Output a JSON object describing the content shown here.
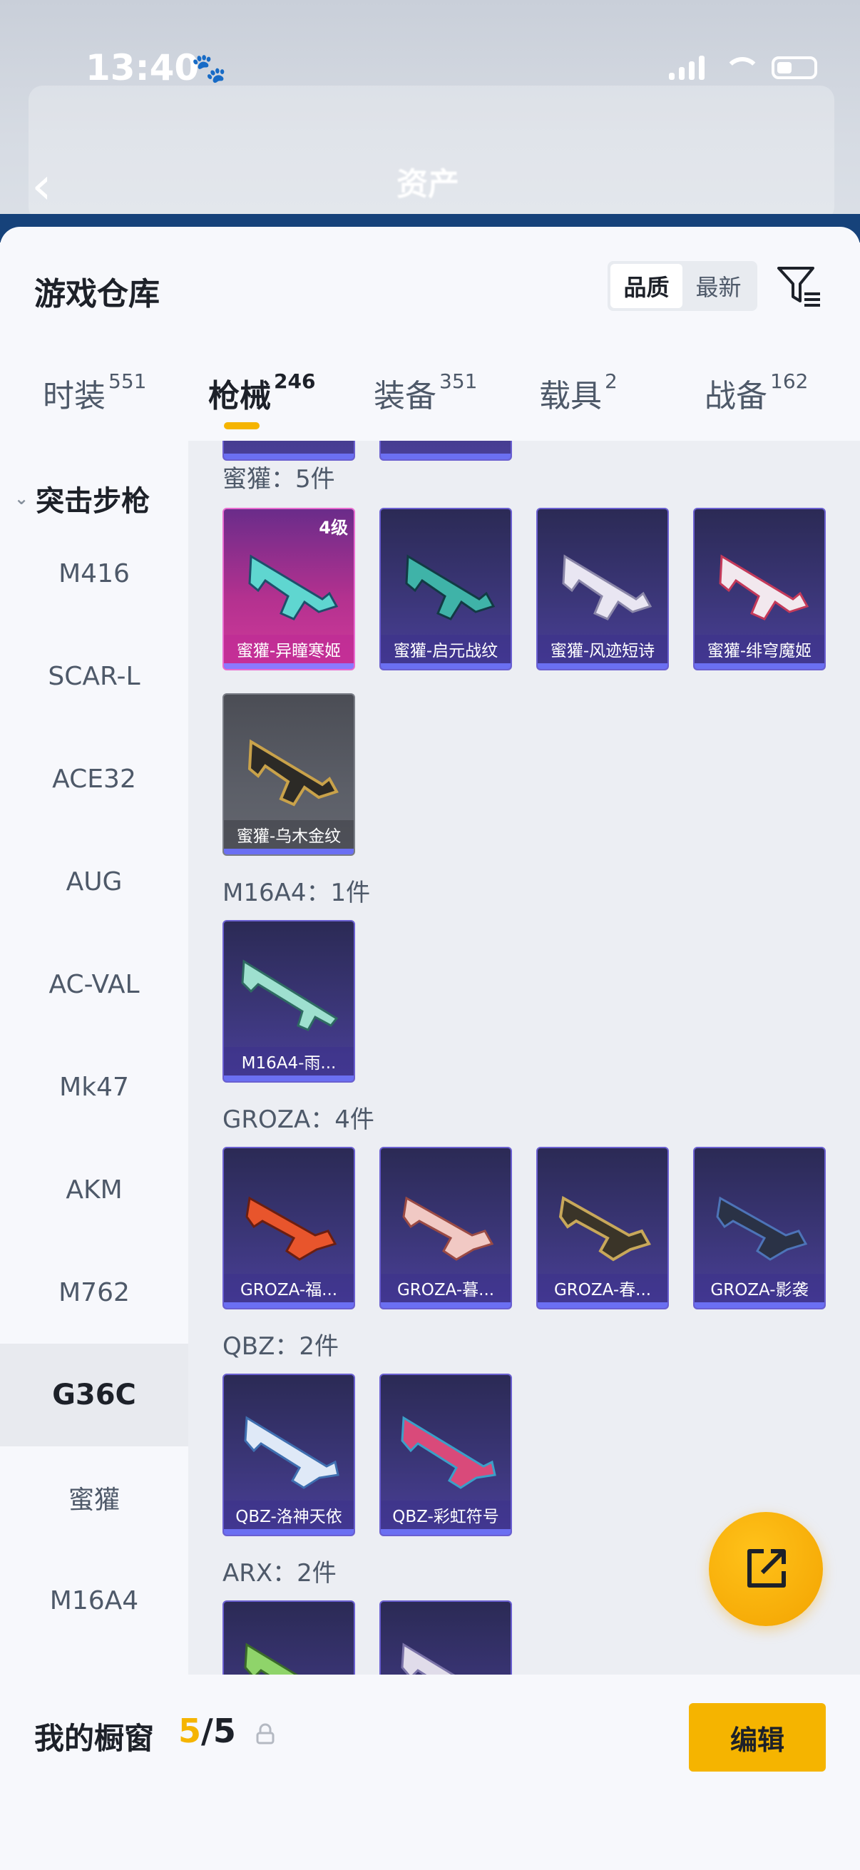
{
  "status_bar": {
    "time": "13:40"
  },
  "header": {
    "title": "资产"
  },
  "sheet": {
    "title": "游戏仓库",
    "sort_options": [
      "品质",
      "最新"
    ],
    "sort_active": "品质"
  },
  "tabs": [
    {
      "label": "时装",
      "count": "551"
    },
    {
      "label": "枪械",
      "count": "246"
    },
    {
      "label": "装备",
      "count": "351"
    },
    {
      "label": "载具",
      "count": "2"
    },
    {
      "label": "战备",
      "count": "162"
    }
  ],
  "sidebar": {
    "group_label": "突击步枪",
    "items": [
      "M416",
      "SCAR-L",
      "ACE32",
      "AUG",
      "AC-VAL",
      "Mk47",
      "AKM",
      "M762",
      "G36C",
      "蜜獾",
      "M16A4"
    ],
    "selected": "G36C"
  },
  "sections": [
    {
      "title": "蜜獾：5件",
      "items": [
        {
          "name": "蜜獾-异瞳寒姬",
          "level": "4级",
          "rarity": "pink"
        },
        {
          "name": "蜜獾-启元战纹",
          "rarity": "purple"
        },
        {
          "name": "蜜獾-风迹短诗",
          "rarity": "purple"
        },
        {
          "name": "蜜獾-绯穹魔姬",
          "rarity": "purple"
        },
        {
          "name": "蜜獾-乌木金纹",
          "rarity": "gray"
        }
      ]
    },
    {
      "title": "M16A4：1件",
      "items": [
        {
          "name": "M16A4-雨...",
          "rarity": "purple"
        }
      ]
    },
    {
      "title": "GROZA：4件",
      "items": [
        {
          "name": "GROZA-福...",
          "rarity": "purple"
        },
        {
          "name": "GROZA-暮...",
          "rarity": "purple"
        },
        {
          "name": "GROZA-春...",
          "rarity": "purple"
        },
        {
          "name": "GROZA-影袭",
          "rarity": "purple"
        }
      ]
    },
    {
      "title": "QBZ：2件",
      "items": [
        {
          "name": "QBZ-洛神天依",
          "rarity": "purple"
        },
        {
          "name": "QBZ-彩虹符号",
          "rarity": "purple"
        }
      ]
    },
    {
      "title": "ARX：2件",
      "items": []
    }
  ],
  "showcase": {
    "title": "我的橱窗",
    "current": "5",
    "total": "/5",
    "edit_label": "编辑"
  },
  "colors": {
    "accent": "#f5b400",
    "purple_card": "#3b3678",
    "pink_card": "#b3318f",
    "gray_card": "#5c5f68"
  },
  "icons": [
    "paw-icon",
    "signal-icon",
    "wifi-icon",
    "battery-icon",
    "back-arrow-icon",
    "filter-icon",
    "chevron-down-icon",
    "share-icon",
    "lock-icon",
    "gun-icon"
  ]
}
